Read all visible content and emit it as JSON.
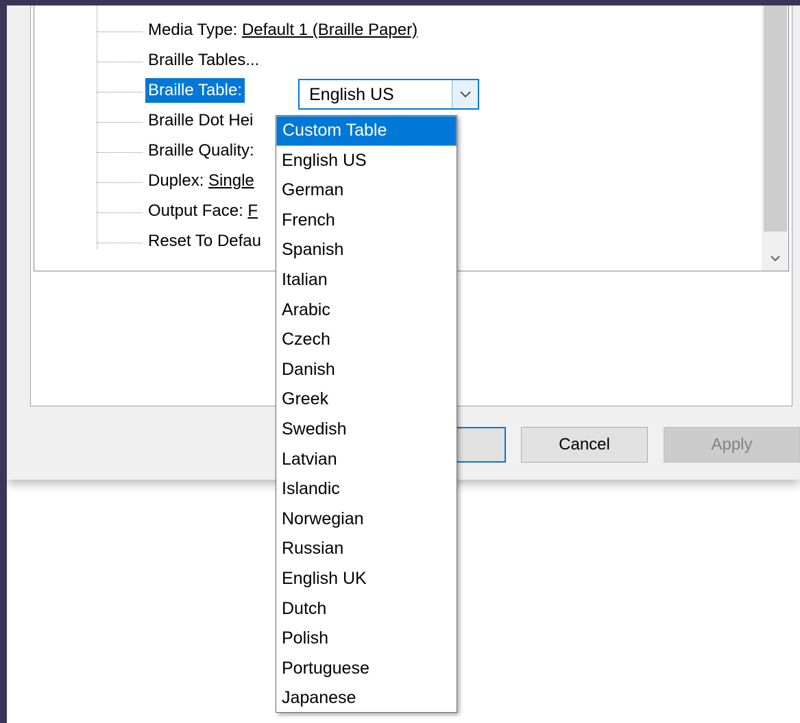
{
  "tree": {
    "items": [
      {
        "prefix": "Media Type: ",
        "value": "Default 1 (Braille Paper)"
      },
      {
        "prefix": "Braille Tables...",
        "value": ""
      },
      {
        "prefix": "Braille Table:",
        "value": ""
      },
      {
        "prefix": "Braille Dot Hei",
        "value": ""
      },
      {
        "prefix": "Braille Quality:",
        "value": ""
      },
      {
        "prefix": "Duplex: ",
        "value": "Single"
      },
      {
        "prefix": "Output Face: ",
        "value": "F"
      },
      {
        "prefix": "Reset To Defau",
        "value": ""
      }
    ]
  },
  "combo": {
    "selected": "English US"
  },
  "dropdown": {
    "options": [
      "Custom Table",
      "English US",
      "German",
      "French",
      "Spanish",
      "Italian",
      "Arabic",
      "Czech",
      "Danish",
      "Greek",
      "Swedish",
      "Latvian",
      "Islandic",
      "Norwegian",
      "Russian",
      "English UK",
      "Dutch",
      "Polish",
      "Portuguese",
      "Japanese"
    ],
    "highlighted_index": 0
  },
  "buttons": {
    "cancel": "Cancel",
    "apply": "Apply"
  },
  "colors": {
    "accent": "#0078d7",
    "outer_frame": "#3b3558"
  }
}
